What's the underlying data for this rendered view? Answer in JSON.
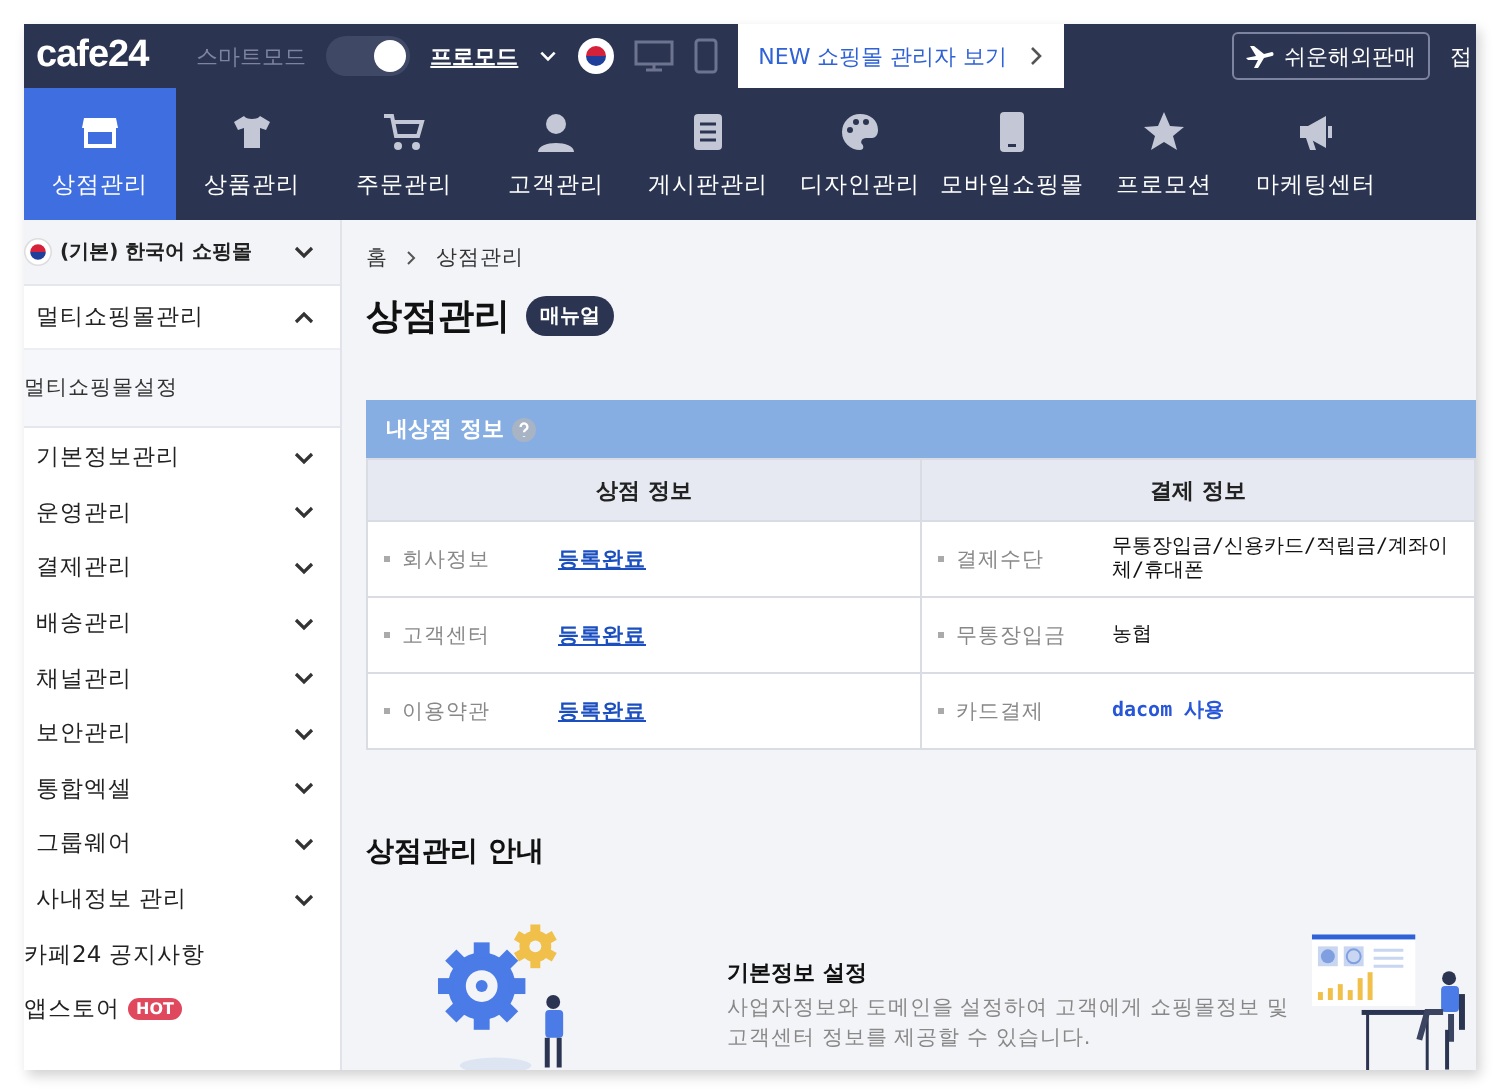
{
  "topbar": {
    "logo": "cafe24",
    "mode_label": "스마트모드",
    "pro_mode": {
      "label": "프로모드",
      "on": true
    },
    "new_admin_button": "NEW 쇼핑몰 관리자 보기",
    "overseas_button": "쉬운해외판매",
    "cut_text": "접"
  },
  "nav": [
    {
      "label": "상점관리",
      "selected": true
    },
    {
      "label": "상품관리",
      "selected": false
    },
    {
      "label": "주문관리",
      "selected": false
    },
    {
      "label": "고객관리",
      "selected": false
    },
    {
      "label": "게시판관리",
      "selected": false
    },
    {
      "label": "디자인관리",
      "selected": false
    },
    {
      "label": "모바일쇼핑몰",
      "selected": false
    },
    {
      "label": "프로모션",
      "selected": false
    },
    {
      "label": "마케팅센터",
      "selected": false
    }
  ],
  "sidebar": {
    "shop_selector": "(기본) 한국어 쇼핑몰",
    "menu": [
      {
        "kind": "group",
        "label": "멀티쇼핑몰관리",
        "expanded": true,
        "children": [
          {
            "label": "멀티쇼핑몰설정"
          }
        ]
      },
      {
        "kind": "group",
        "label": "기본정보관리",
        "expanded": false
      },
      {
        "kind": "group",
        "label": "운영관리",
        "expanded": false
      },
      {
        "kind": "group",
        "label": "결제관리",
        "expanded": false
      },
      {
        "kind": "group",
        "label": "배송관리",
        "expanded": false
      },
      {
        "kind": "group",
        "label": "채널관리",
        "expanded": false
      },
      {
        "kind": "group",
        "label": "보안관리",
        "expanded": false
      },
      {
        "kind": "group",
        "label": "통합엑셀",
        "expanded": false
      },
      {
        "kind": "group",
        "label": "그룹웨어",
        "expanded": false
      },
      {
        "kind": "group",
        "label": "사내정보 관리",
        "expanded": false
      },
      {
        "kind": "link",
        "label": "카페24 공지사항"
      },
      {
        "kind": "link",
        "label": "앱스토어",
        "badge": "HOT"
      }
    ]
  },
  "main": {
    "breadcrumb": [
      "홈",
      "상점관리"
    ],
    "title": "상점관리",
    "manual_badge": "매뉴얼",
    "info_section": {
      "title": "내상점 정보",
      "columns": [
        "상점 정보",
        "결제 정보"
      ],
      "rows": [
        {
          "store_label": "회사정보",
          "store_value": "등록완료",
          "pay_label": "결제수단",
          "pay_value": "무통장입금/신용카드/적립금/계좌이체/휴대폰",
          "highlighted": false
        },
        {
          "store_label": "고객센터",
          "store_value": "등록완료",
          "pay_label": "무통장입금",
          "pay_value": "농협",
          "highlighted": false
        },
        {
          "store_label": "이용약관",
          "store_value": "등록완료",
          "pay_label": "카드결제",
          "pay_value": "dacom 사용",
          "highlighted": true
        }
      ]
    },
    "guide": {
      "title": "상점관리 안내",
      "items": [
        {
          "title": "기본정보 설정",
          "description": "사업자정보와 도메인을 설정하여 고객에게 쇼핑몰정보 및 고객센터 정보를 제공할 수 있습니다."
        }
      ]
    }
  }
}
